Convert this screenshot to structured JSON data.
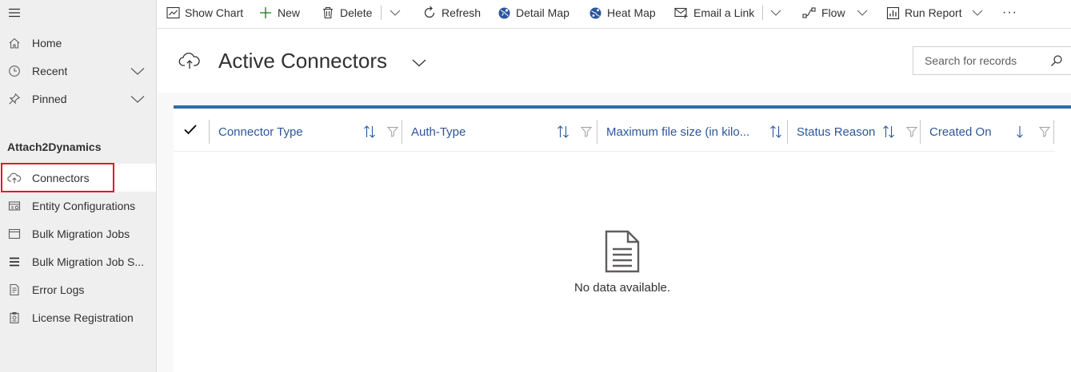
{
  "sidebar": {
    "items": [
      {
        "label": "Home"
      },
      {
        "label": "Recent"
      },
      {
        "label": "Pinned"
      }
    ],
    "group_title": "Attach2Dynamics",
    "group_items": [
      {
        "label": "Connectors"
      },
      {
        "label": "Entity Configurations"
      },
      {
        "label": "Bulk Migration Jobs"
      },
      {
        "label": "Bulk Migration Job S..."
      },
      {
        "label": "Error Logs"
      },
      {
        "label": "License Registration"
      }
    ]
  },
  "toolbar": {
    "show_chart": "Show Chart",
    "new": "New",
    "delete": "Delete",
    "refresh": "Refresh",
    "detail_map": "Detail Map",
    "heat_map": "Heat Map",
    "email_link": "Email a Link",
    "flow": "Flow",
    "run_report": "Run Report",
    "more": "···"
  },
  "view": {
    "title": "Active Connectors"
  },
  "search": {
    "placeholder": "Search for records"
  },
  "grid": {
    "columns": [
      {
        "label": "Connector Type"
      },
      {
        "label": "Auth-Type"
      },
      {
        "label": "Maximum file size (in kilo..."
      },
      {
        "label": "Status Reason"
      },
      {
        "label": "Created On"
      }
    ],
    "empty_message": "No data available."
  },
  "colors": {
    "accent": "#2f6cad",
    "column_text": "#2b579a",
    "highlight": "#e81123",
    "new_icon": "#107c10"
  }
}
